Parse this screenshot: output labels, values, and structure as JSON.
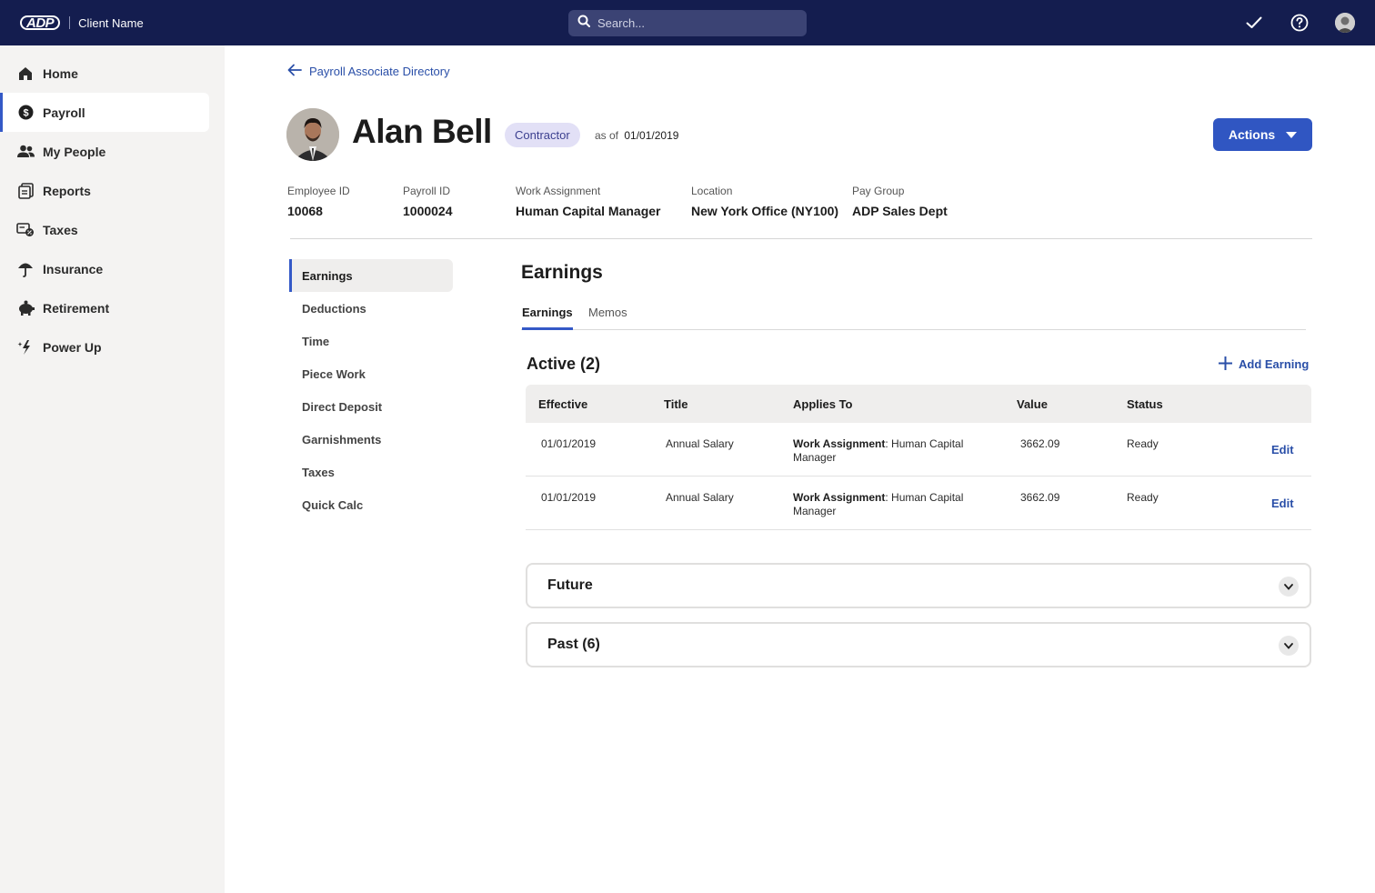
{
  "header": {
    "logo_text": "ADP",
    "client_name": "Client Name",
    "search_placeholder": "Search..."
  },
  "sidebar": {
    "items": [
      {
        "label": "Home",
        "icon": "home-icon"
      },
      {
        "label": "Payroll",
        "icon": "dollar-circle-icon",
        "active": true
      },
      {
        "label": "My People",
        "icon": "people-icon"
      },
      {
        "label": "Reports",
        "icon": "reports-icon"
      },
      {
        "label": "Taxes",
        "icon": "taxes-icon"
      },
      {
        "label": "Insurance",
        "icon": "umbrella-icon"
      },
      {
        "label": "Retirement",
        "icon": "piggy-bank-icon"
      },
      {
        "label": "Power Up",
        "icon": "sparkle-icon"
      }
    ]
  },
  "breadcrumb": {
    "back_label": "Payroll Associate Directory"
  },
  "employee": {
    "name": "Alan Bell",
    "type_badge": "Contractor",
    "as_of_label": "as of",
    "as_of_date": "01/01/2019",
    "fields": [
      {
        "label": "Employee ID",
        "value": "10068"
      },
      {
        "label": "Payroll ID",
        "value": "1000024"
      },
      {
        "label": "Work Assignment",
        "value": "Human Capital Manager"
      },
      {
        "label": "Location",
        "value": "New York Office (NY100)"
      },
      {
        "label": "Pay Group",
        "value": "ADP Sales Dept"
      }
    ]
  },
  "actions_label": "Actions",
  "subnav": {
    "items": [
      "Earnings",
      "Deductions",
      "Time",
      "Piece Work",
      "Direct Deposit",
      "Garnishments",
      "Taxes",
      "Quick Calc"
    ],
    "active": "Earnings"
  },
  "content": {
    "title": "Earnings",
    "tabs": [
      "Earnings",
      "Memos"
    ],
    "active_header": "Active (2)",
    "add_label": "Add Earning",
    "columns": [
      "Effective",
      "Title",
      "Applies To",
      "Value",
      "Status"
    ],
    "rows": [
      {
        "effective": "01/01/2019",
        "title": "Annual Salary",
        "applies_key": "Work Assignment",
        "applies_value": ": Human Capital Manager",
        "value": "3662.09",
        "status": "Ready",
        "action": "Edit"
      },
      {
        "effective": "01/01/2019",
        "title": "Annual Salary",
        "applies_key": "Work Assignment",
        "applies_value": ": Human Capital Manager",
        "value": "3662.09",
        "status": "Ready",
        "action": "Edit"
      }
    ],
    "future_label": "Future",
    "past_label": "Past (6)"
  },
  "colors": {
    "topbar": "#141d4f",
    "accent": "#3056c2",
    "link": "#2a4fa8",
    "badge_bg": "#e2e0f6"
  }
}
